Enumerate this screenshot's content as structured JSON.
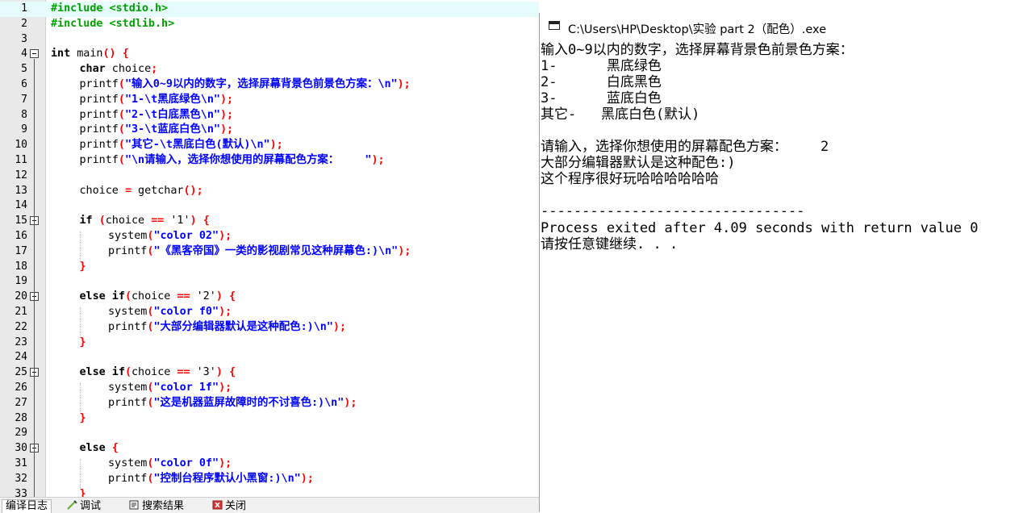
{
  "editor": {
    "lines": [
      {
        "n": "1",
        "fold": false,
        "active": true,
        "indent": 0,
        "tokens": [
          {
            "c": "pp",
            "t": "#include <stdio.h>"
          }
        ]
      },
      {
        "n": "2",
        "fold": false,
        "indent": 0,
        "tokens": [
          {
            "c": "pp",
            "t": "#include <stdlib.h>"
          }
        ]
      },
      {
        "n": "3",
        "fold": false,
        "indent": 0,
        "tokens": []
      },
      {
        "n": "4",
        "fold": true,
        "indent": 0,
        "tokens": [
          {
            "c": "kw",
            "t": "int"
          },
          {
            "c": "",
            "t": " main"
          },
          {
            "c": "sym",
            "t": "()"
          },
          {
            "c": "",
            "t": " "
          },
          {
            "c": "sym",
            "t": "{"
          }
        ]
      },
      {
        "n": "5",
        "fold": false,
        "indent": 1,
        "tokens": [
          {
            "c": "kw",
            "t": "char"
          },
          {
            "c": "",
            "t": " choice"
          },
          {
            "c": "sym",
            "t": ";"
          }
        ]
      },
      {
        "n": "6",
        "fold": false,
        "indent": 1,
        "tokens": [
          {
            "c": "",
            "t": "printf"
          },
          {
            "c": "sym",
            "t": "("
          },
          {
            "c": "str",
            "t": "\"输入0~9以内的数字，选择屏幕背景色前景色方案：\\n\""
          },
          {
            "c": "sym",
            "t": ");"
          }
        ]
      },
      {
        "n": "7",
        "fold": false,
        "indent": 1,
        "tokens": [
          {
            "c": "",
            "t": "printf"
          },
          {
            "c": "sym",
            "t": "("
          },
          {
            "c": "str",
            "t": "\"1-\\t黑底绿色\\n\""
          },
          {
            "c": "sym",
            "t": ");"
          }
        ]
      },
      {
        "n": "8",
        "fold": false,
        "indent": 1,
        "tokens": [
          {
            "c": "",
            "t": "printf"
          },
          {
            "c": "sym",
            "t": "("
          },
          {
            "c": "str",
            "t": "\"2-\\t白底黑色\\n\""
          },
          {
            "c": "sym",
            "t": ");"
          }
        ]
      },
      {
        "n": "9",
        "fold": false,
        "indent": 1,
        "tokens": [
          {
            "c": "",
            "t": "printf"
          },
          {
            "c": "sym",
            "t": "("
          },
          {
            "c": "str",
            "t": "\"3-\\t蓝底白色\\n\""
          },
          {
            "c": "sym",
            "t": ");"
          }
        ]
      },
      {
        "n": "10",
        "fold": false,
        "indent": 1,
        "tokens": [
          {
            "c": "",
            "t": "printf"
          },
          {
            "c": "sym",
            "t": "("
          },
          {
            "c": "str",
            "t": "\"其它-\\t黑底白色(默认)\\n\""
          },
          {
            "c": "sym",
            "t": ");"
          }
        ]
      },
      {
        "n": "11",
        "fold": false,
        "indent": 1,
        "tokens": [
          {
            "c": "",
            "t": "printf"
          },
          {
            "c": "sym",
            "t": "("
          },
          {
            "c": "str",
            "t": "\"\\n请输入，选择你想使用的屏幕配色方案：    \""
          },
          {
            "c": "sym",
            "t": ");"
          }
        ]
      },
      {
        "n": "12",
        "fold": false,
        "indent": 1,
        "tokens": []
      },
      {
        "n": "13",
        "fold": false,
        "indent": 1,
        "tokens": [
          {
            "c": "",
            "t": "choice "
          },
          {
            "c": "sym",
            "t": "="
          },
          {
            "c": "",
            "t": " getchar"
          },
          {
            "c": "sym",
            "t": "();"
          }
        ]
      },
      {
        "n": "14",
        "fold": false,
        "indent": 1,
        "tokens": []
      },
      {
        "n": "15",
        "fold": true,
        "indent": 1,
        "tokens": [
          {
            "c": "kw",
            "t": "if"
          },
          {
            "c": "",
            "t": " "
          },
          {
            "c": "sym",
            "t": "("
          },
          {
            "c": "",
            "t": "choice "
          },
          {
            "c": "sym",
            "t": "=="
          },
          {
            "c": "",
            "t": " '1'"
          },
          {
            "c": "sym",
            "t": ")"
          },
          {
            "c": "",
            "t": " "
          },
          {
            "c": "sym",
            "t": "{"
          }
        ]
      },
      {
        "n": "16",
        "fold": false,
        "indent": 2,
        "tokens": [
          {
            "c": "",
            "t": "system"
          },
          {
            "c": "sym",
            "t": "("
          },
          {
            "c": "str",
            "t": "\"color 02\""
          },
          {
            "c": "sym",
            "t": ");"
          }
        ]
      },
      {
        "n": "17",
        "fold": false,
        "indent": 2,
        "tokens": [
          {
            "c": "",
            "t": "printf"
          },
          {
            "c": "sym",
            "t": "("
          },
          {
            "c": "str",
            "t": "\"《黑客帝国》一类的影视剧常见这种屏幕色:)\\n\""
          },
          {
            "c": "sym",
            "t": ");"
          }
        ]
      },
      {
        "n": "18",
        "fold": false,
        "indent": 1,
        "tokens": [
          {
            "c": "sym",
            "t": "}"
          }
        ]
      },
      {
        "n": "19",
        "fold": false,
        "indent": 1,
        "tokens": []
      },
      {
        "n": "20",
        "fold": true,
        "indent": 1,
        "tokens": [
          {
            "c": "kw",
            "t": "else if"
          },
          {
            "c": "sym",
            "t": "("
          },
          {
            "c": "",
            "t": "choice "
          },
          {
            "c": "sym",
            "t": "=="
          },
          {
            "c": "",
            "t": " '2'"
          },
          {
            "c": "sym",
            "t": ")"
          },
          {
            "c": "",
            "t": " "
          },
          {
            "c": "sym",
            "t": "{"
          }
        ]
      },
      {
        "n": "21",
        "fold": false,
        "indent": 2,
        "tokens": [
          {
            "c": "",
            "t": "system"
          },
          {
            "c": "sym",
            "t": "("
          },
          {
            "c": "str",
            "t": "\"color f0\""
          },
          {
            "c": "sym",
            "t": ");"
          }
        ]
      },
      {
        "n": "22",
        "fold": false,
        "indent": 2,
        "tokens": [
          {
            "c": "",
            "t": "printf"
          },
          {
            "c": "sym",
            "t": "("
          },
          {
            "c": "str",
            "t": "\"大部分编辑器默认是这种配色:)\\n\""
          },
          {
            "c": "sym",
            "t": ");"
          }
        ]
      },
      {
        "n": "23",
        "fold": false,
        "indent": 1,
        "tokens": [
          {
            "c": "sym",
            "t": "}"
          }
        ]
      },
      {
        "n": "24",
        "fold": false,
        "indent": 1,
        "tokens": []
      },
      {
        "n": "25",
        "fold": true,
        "indent": 1,
        "tokens": [
          {
            "c": "kw",
            "t": "else if"
          },
          {
            "c": "sym",
            "t": "("
          },
          {
            "c": "",
            "t": "choice "
          },
          {
            "c": "sym",
            "t": "=="
          },
          {
            "c": "",
            "t": " '3'"
          },
          {
            "c": "sym",
            "t": ")"
          },
          {
            "c": "",
            "t": " "
          },
          {
            "c": "sym",
            "t": "{"
          }
        ]
      },
      {
        "n": "26",
        "fold": false,
        "indent": 2,
        "tokens": [
          {
            "c": "",
            "t": "system"
          },
          {
            "c": "sym",
            "t": "("
          },
          {
            "c": "str",
            "t": "\"color 1f\""
          },
          {
            "c": "sym",
            "t": ");"
          }
        ]
      },
      {
        "n": "27",
        "fold": false,
        "indent": 2,
        "tokens": [
          {
            "c": "",
            "t": "printf"
          },
          {
            "c": "sym",
            "t": "("
          },
          {
            "c": "str",
            "t": "\"这是机器蓝屏故障时的不讨喜色:)\\n\""
          },
          {
            "c": "sym",
            "t": ");"
          }
        ]
      },
      {
        "n": "28",
        "fold": false,
        "indent": 1,
        "tokens": [
          {
            "c": "sym",
            "t": "}"
          }
        ]
      },
      {
        "n": "29",
        "fold": false,
        "indent": 1,
        "tokens": []
      },
      {
        "n": "30",
        "fold": true,
        "indent": 1,
        "tokens": [
          {
            "c": "kw",
            "t": "else"
          },
          {
            "c": "",
            "t": " "
          },
          {
            "c": "sym",
            "t": "{"
          }
        ]
      },
      {
        "n": "31",
        "fold": false,
        "indent": 2,
        "tokens": [
          {
            "c": "",
            "t": "system"
          },
          {
            "c": "sym",
            "t": "("
          },
          {
            "c": "str",
            "t": "\"color 0f\""
          },
          {
            "c": "sym",
            "t": ");"
          }
        ]
      },
      {
        "n": "32",
        "fold": false,
        "indent": 2,
        "tokens": [
          {
            "c": "",
            "t": "printf"
          },
          {
            "c": "sym",
            "t": "("
          },
          {
            "c": "str",
            "t": "\"控制台程序默认小黑窗:)\\n\""
          },
          {
            "c": "sym",
            "t": ");"
          }
        ]
      },
      {
        "n": "33",
        "fold": false,
        "indent": 1,
        "tokens": [
          {
            "c": "sym",
            "t": "}"
          }
        ]
      }
    ]
  },
  "bottom_tabs": [
    {
      "label": "编译日志",
      "icon": "compile-log-icon",
      "selected": true
    },
    {
      "label": "调试",
      "icon": "debug-icon",
      "selected": false
    },
    {
      "label": "搜索结果",
      "icon": "search-results-icon",
      "selected": false
    },
    {
      "label": "关闭",
      "icon": "close-icon",
      "selected": false
    }
  ],
  "console": {
    "title": "C:\\Users\\HP\\Desktop\\实验 part 2（配色）.exe",
    "lines": [
      "输入0~9以内的数字，选择屏幕背景色前景色方案：",
      "1-      黑底绿色",
      "2-      白底黑色",
      "3-      蓝底白色",
      "其它-   黑底白色(默认)",
      "",
      "请输入，选择你想使用的屏幕配色方案：    2",
      "大部分编辑器默认是这种配色:)",
      "这个程序很好玩哈哈哈哈哈哈",
      "",
      "--------------------------------",
      "Process exited after 4.09 seconds with return value 0",
      "请按任意键继续. . ."
    ]
  },
  "colors": {
    "preprocessor": "#00a000",
    "string": "#0000ff",
    "symbol": "#ff0000",
    "active_line": "#e6fbfb"
  }
}
